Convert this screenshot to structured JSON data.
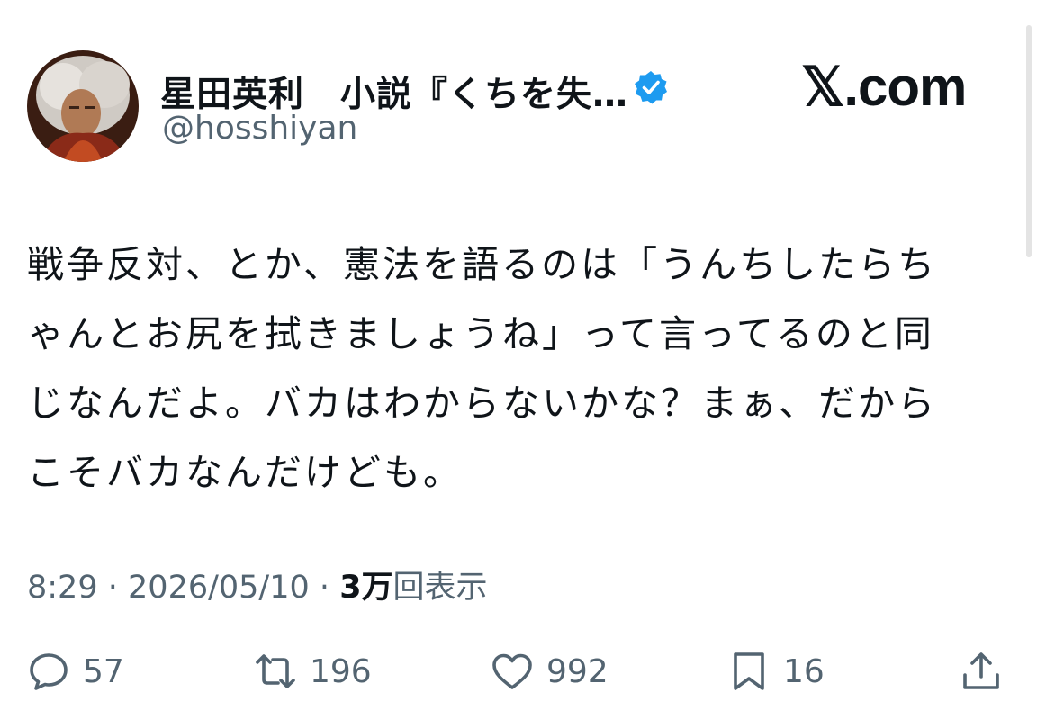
{
  "author": {
    "display_name": "星田英利　小説『くちを失…",
    "handle": "@hosshiyan",
    "verified": true,
    "avatar": "portrait-with-grey-hair"
  },
  "brand": {
    "label": "𝕏.com"
  },
  "tweet": {
    "lines": [
      "戦争反対、とか、憲法を語るのは「うんちしたらち",
      "ゃんとお尻を拭きましょうね」って言ってるのと同",
      "じなんだよ。バカはわからないかな？まぁ、だから",
      "こそバカなんだけども。"
    ]
  },
  "meta": {
    "time": "8:29",
    "separator": "·",
    "date": "2026/05/10",
    "views_count": "3万",
    "views_label": "回表示"
  },
  "actions": {
    "reply": {
      "icon": "reply-icon",
      "count": "57"
    },
    "repost": {
      "icon": "repost-icon",
      "count": "196"
    },
    "like": {
      "icon": "heart-icon",
      "count": "992"
    },
    "bookmark": {
      "icon": "bookmark-icon",
      "count": "16"
    },
    "share": {
      "icon": "share-icon"
    }
  },
  "colors": {
    "text": "#0f1419",
    "secondary": "#536471",
    "verified": "#1d9bf0",
    "background": "#ffffff"
  }
}
